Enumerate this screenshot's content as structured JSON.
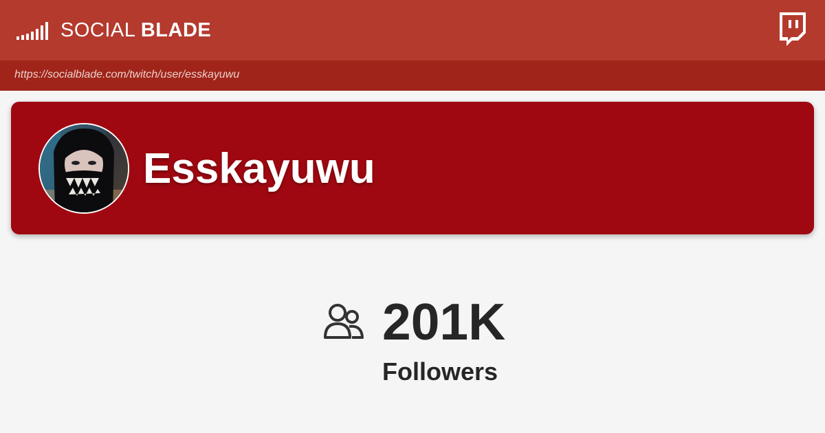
{
  "brand": {
    "name_light": "SOCIAL",
    "name_bold": "BLADE",
    "logo_icon": "signal-bars-icon"
  },
  "platform": {
    "icon": "twitch-icon"
  },
  "url": "https://socialblade.com/twitch/user/esskayuwu",
  "profile": {
    "channel_name": "Esskayuwu",
    "avatar": "channel-avatar"
  },
  "stat": {
    "icon": "users-icon",
    "value": "201K",
    "label": "Followers"
  },
  "colors": {
    "header": "#b43a2e",
    "url_bar": "#a02419",
    "card": "#a00811",
    "background": "#f5f5f5",
    "text_dark": "#262626"
  }
}
